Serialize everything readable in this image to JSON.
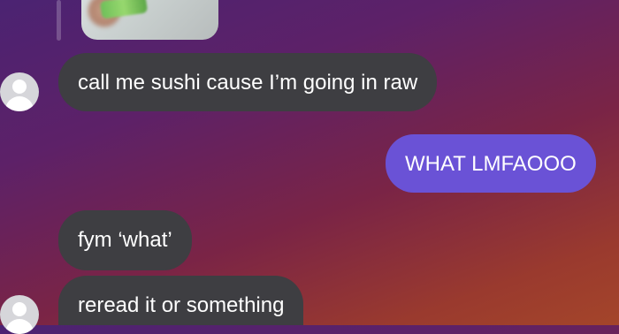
{
  "messages": [
    {
      "id": "msg-1",
      "direction": "incoming",
      "text": "call me sushi cause I’m going in raw"
    },
    {
      "id": "msg-2",
      "direction": "outgoing",
      "text": "WHAT LMFAOOO"
    },
    {
      "id": "msg-3",
      "direction": "incoming",
      "text": "fym ‘what’"
    },
    {
      "id": "msg-4",
      "direction": "incoming",
      "text": "reread it or something"
    }
  ],
  "colors": {
    "incoming_bubble": "#3e3e42",
    "outgoing_bubble": "#6a52d6",
    "text": "#ffffff",
    "avatar_bg": "#d6d6da"
  },
  "icons": {
    "avatar": "default-user-avatar-icon"
  }
}
